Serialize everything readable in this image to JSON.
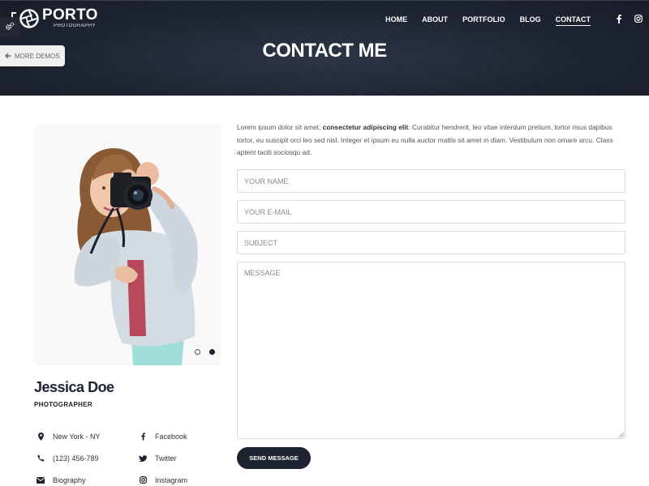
{
  "logo": {
    "title": "PORTO",
    "subtitle": "PHOTOGRAPHY"
  },
  "nav": {
    "items": [
      {
        "label": "HOME"
      },
      {
        "label": "ABOUT"
      },
      {
        "label": "PORTFOLIO"
      },
      {
        "label": "BLOG"
      },
      {
        "label": "CONTACT",
        "active": true
      }
    ],
    "social": [
      "facebook-icon",
      "instagram-icon"
    ]
  },
  "page": {
    "title": "CONTACT ME"
  },
  "demo": {
    "more_demos_label": "MORE DEMOS"
  },
  "carousel": {
    "slides": 2,
    "active_slide": 2
  },
  "profile": {
    "name": "Jessica Doe",
    "role": "PHOTOGRAPHER",
    "contacts_left": [
      {
        "icon": "map-marker-icon",
        "label": "New York - NY"
      },
      {
        "icon": "phone-icon",
        "label": "(123) 456-789"
      },
      {
        "icon": "envelope-icon",
        "label": "Biography"
      }
    ],
    "contacts_right": [
      {
        "icon": "facebook-icon",
        "label": "Facebook"
      },
      {
        "icon": "twitter-icon",
        "label": "Twitter"
      },
      {
        "icon": "instagram-icon",
        "label": "Instagram"
      }
    ]
  },
  "intro": {
    "lead": "Lorem ipsum dolor sit amet, ",
    "bold": "consectetur adipiscing elit",
    "rest": ". Curabitur hendrerit, leo vitae interdum pretium, tortor risus dapibus tortor, eu suscipit orci leo sed nisl. Integer et ipsum eu nulla auctor mattis sit amet in diam. Vestibulum non ornare arcu. Class aptent taciti sociosqu ad."
  },
  "form": {
    "name_placeholder": "YOUR NAME",
    "email_placeholder": "YOUR E-MAIL",
    "subject_placeholder": "SUBJECT",
    "message_placeholder": "MESSAGE",
    "submit_label": "SEND MESSAGE"
  },
  "colors": {
    "header_bg": "#1d2331",
    "accent": "#1d2331",
    "text": "#333333"
  }
}
